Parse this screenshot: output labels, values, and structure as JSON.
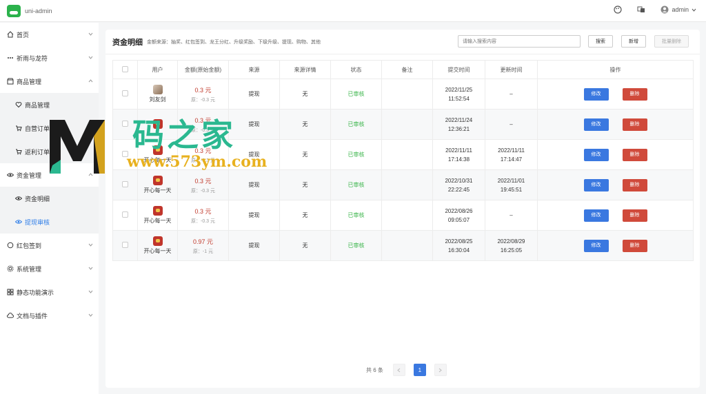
{
  "topbar": {
    "app_title": "uni-admin",
    "user_name": "admin"
  },
  "sidebar": {
    "items": [
      {
        "label": "首页",
        "icon": "home-icon"
      },
      {
        "label": "祈雨与龙符",
        "icon": "dots-icon"
      },
      {
        "label": "商品管理",
        "icon": "shop-icon"
      },
      {
        "label": "资金管理",
        "icon": "eye-icon"
      },
      {
        "label": "红包签到",
        "icon": "circle-icon"
      },
      {
        "label": "系统管理",
        "icon": "gear-icon"
      },
      {
        "label": "静态功能演示",
        "icon": "grid-icon"
      },
      {
        "label": "文档与插件",
        "icon": "cloud-icon"
      }
    ],
    "goods_sub": [
      {
        "label": "商品管理",
        "icon": "heart-icon"
      },
      {
        "label": "自营订单",
        "icon": "cart-icon"
      },
      {
        "label": "返利订单",
        "icon": "cart-icon"
      }
    ],
    "fund_sub": [
      {
        "label": "资金明细",
        "icon": "eye-icon"
      },
      {
        "label": "提现审核",
        "icon": "eye-icon"
      }
    ]
  },
  "card": {
    "title": "资金明细",
    "subtitle": "金额来源：抽奖、红包签到、龙王分红、升级奖励、下级升级、提现、购物、其他",
    "search_placeholder": "请输入搜索内容",
    "search_label": "搜索",
    "add_label": "新增",
    "batch_delete_label": "批量删除"
  },
  "table": {
    "headers": [
      "用户",
      "金额(原始金额)",
      "来源",
      "来源详情",
      "状态",
      "备注",
      "提交时间",
      "更新时间",
      "操作"
    ],
    "rows": [
      {
        "user": "刘友剑",
        "amount": "0.3 元",
        "orig": "原：-0.3 元",
        "source": "提现",
        "detail": "无",
        "status": "已审核",
        "note": "",
        "submit": "2022/11/25\n11:52:54",
        "update": "–",
        "photo": true
      },
      {
        "user": "",
        "amount": "0.3 元",
        "orig": "原：-0.3 元",
        "source": "提现",
        "detail": "无",
        "status": "已审核",
        "note": "",
        "submit": "2022/11/24\n12:36:21",
        "update": "–",
        "photo": false
      },
      {
        "user": "开心每一天",
        "amount": "0.3 元",
        "orig": "原：-0.3 元",
        "source": "提现",
        "detail": "无",
        "status": "已审核",
        "note": "",
        "submit": "2022/11/11\n17:14:38",
        "update": "2022/11/11\n17:14:47",
        "photo": false
      },
      {
        "user": "开心每一天",
        "amount": "0.3 元",
        "orig": "原：-0.3 元",
        "source": "提现",
        "detail": "无",
        "status": "已审核",
        "note": "",
        "submit": "2022/10/31\n22:22:45",
        "update": "2022/11/01\n19:45:51",
        "photo": false
      },
      {
        "user": "开心每一天",
        "amount": "0.3 元",
        "orig": "原：-0.3 元",
        "source": "提现",
        "detail": "无",
        "status": "已审核",
        "note": "",
        "submit": "2022/08/26\n09:05:07",
        "update": "–",
        "photo": false
      },
      {
        "user": "开心每一天",
        "amount": "0.97 元",
        "orig": "原：-1 元",
        "source": "提现",
        "detail": "无",
        "status": "已审核",
        "note": "",
        "submit": "2022/08/25\n16:30:04",
        "update": "2022/08/29\n16:25:05",
        "photo": false
      }
    ],
    "edit_label": "修改",
    "delete_label": "删除"
  },
  "pager": {
    "total": "共 6 条",
    "current": "1"
  },
  "watermark": {
    "brand": "码之家",
    "url": "www.573ym.com"
  },
  "colors": {
    "primary": "#3a78e0",
    "danger": "#d04a3b",
    "success": "#3ab54a",
    "amount": "#c0392b"
  }
}
